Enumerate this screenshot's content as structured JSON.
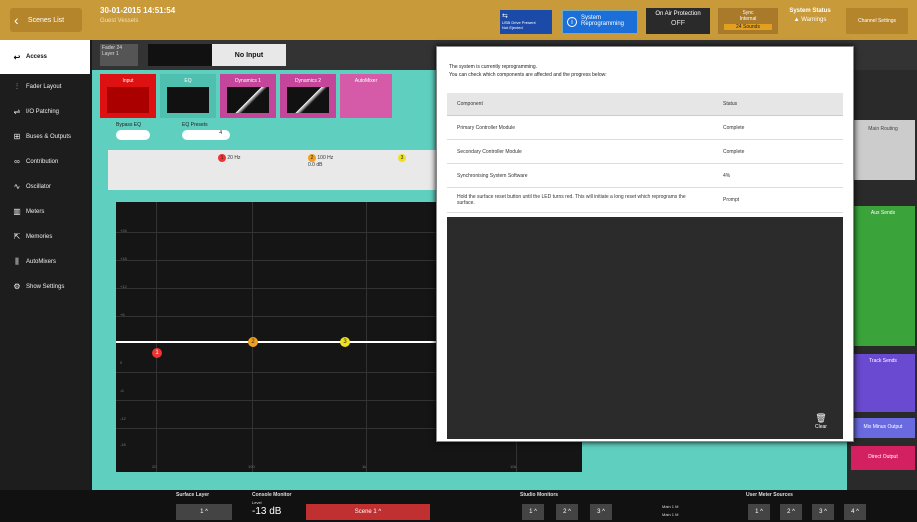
{
  "top": {
    "back_label": "Scenes List",
    "datetime": "30-01-2015 14:51:54",
    "subtitle": "Guest Vessels",
    "usb_label": "USB Drive Present",
    "usb_sub": "Not Ejected",
    "system_label": "System",
    "system_value": "Reprogramming",
    "onair_label": "On Air Protection",
    "onair_value": "OFF",
    "sync_label": "Sync",
    "sync_sub": "Internal",
    "sync_value": "24 Sounds",
    "status_label": "System Status",
    "status_value": "Warnings",
    "ppl_label": "Channel Settings"
  },
  "nav": {
    "items": [
      {
        "label": "Access",
        "icon": "access-icon"
      },
      {
        "label": "Fader Layout",
        "icon": "fader-icon"
      },
      {
        "label": "I/O Patching",
        "icon": "patch-icon"
      },
      {
        "label": "Buses & Outputs",
        "icon": "bus-icon"
      },
      {
        "label": "Contribution",
        "icon": "contribution-icon"
      },
      {
        "label": "Oscillator",
        "icon": "oscillator-icon"
      },
      {
        "label": "Meters",
        "icon": "meters-icon"
      },
      {
        "label": "Memories",
        "icon": "memories-icon"
      },
      {
        "label": "AutoMixers",
        "icon": "automixers-icon"
      },
      {
        "label": "Show Settings",
        "icon": "gear-icon"
      }
    ]
  },
  "header": {
    "fader": "Fader 24",
    "layer": "Layer 1",
    "no_input": "No Input"
  },
  "tabs": [
    "Input",
    "EQ",
    "Dynamics 1",
    "Dynamics 2",
    "AutoMixer"
  ],
  "eq": {
    "bypass_label": "Bypass EQ",
    "slope_label": "EQ Presets",
    "slope_value": "4"
  },
  "bands": [
    {
      "num": "1",
      "freq": "20 Hz",
      "gain": ""
    },
    {
      "num": "2",
      "freq": "100 Hz",
      "gain": "0.0 dB"
    },
    {
      "num": "3",
      "freq": "",
      "gain": ""
    }
  ],
  "graph": {
    "y_labels": [
      "+24",
      "+18",
      "+12",
      "+6",
      "0",
      "-6",
      "-12",
      "-18",
      "-24"
    ],
    "x_labels": [
      "20",
      "100",
      "1k",
      "10k"
    ]
  },
  "dialog": {
    "message_1": "The system is currently reprogramming.",
    "message_2": "You can check which components are affected and the progress below:",
    "col_component": "Component",
    "col_status": "Status",
    "rows": [
      {
        "component": "Primary Controller Module",
        "status": "Complete"
      },
      {
        "component": "Secondary Controller Module",
        "status": "Complete"
      },
      {
        "component": "Synchronising System Software",
        "status": "4%"
      },
      {
        "component": "Hold the surface reset button until the LED turns red. This will initiate a long reset which reprograms the surface.",
        "status": "Prompt"
      }
    ],
    "clear_label": "Clear"
  },
  "right": {
    "main_routing": "Main Routing",
    "aux_sends": "Aux Sends",
    "track_sends": "Track Sends",
    "mix_minus": "Mix Minus Output",
    "direct_output": "Direct Output"
  },
  "bottom": {
    "surface_layer": "Surface Layer",
    "layer_value": "1",
    "console_monitor": "Console Monitor",
    "level_label": "Level",
    "level_value": "-13 dB",
    "source_value": "Scene 1",
    "studio_monitors": "Studio Monitors",
    "user_meter_sources": "User Meter Sources",
    "btn1": "1",
    "btn2": "2",
    "btn3": "3",
    "btn4": "4",
    "main1": "Main 1 M",
    "main2": "Main 1 M"
  }
}
